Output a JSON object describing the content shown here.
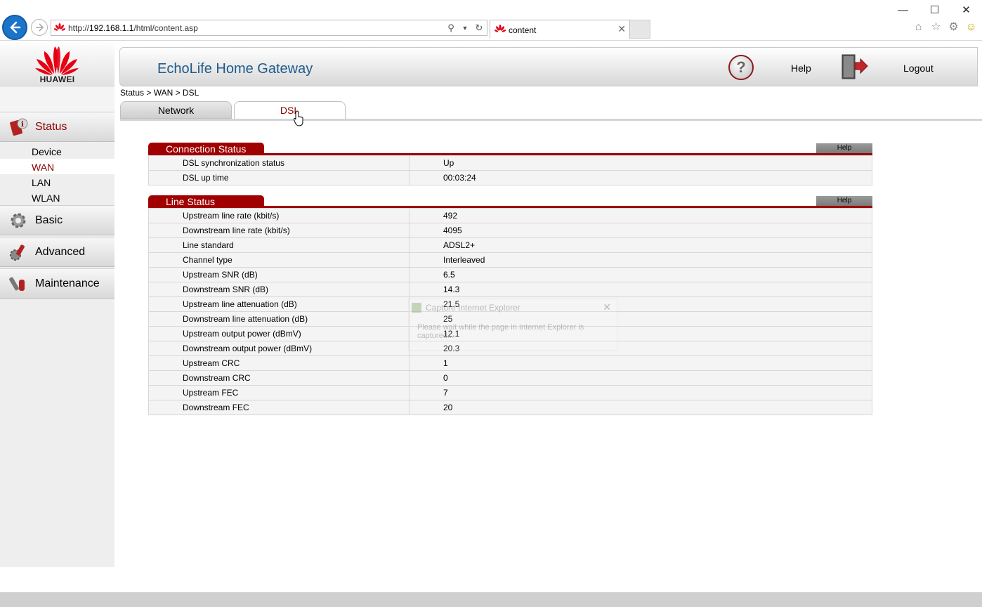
{
  "browser": {
    "url_prefix": "http://",
    "url_host": "192.168.1.1",
    "url_path": "/html/content.asp",
    "tab_title": "content",
    "window_controls": [
      "—",
      "☐",
      "✕"
    ]
  },
  "brand": {
    "logo_text": "HUAWEI",
    "brand_color": "#e60012"
  },
  "header": {
    "title": "EchoLife Home Gateway",
    "help_label": "Help",
    "logout_label": "Logout"
  },
  "sidebar": {
    "status": "Status",
    "sub_items": [
      "Device",
      "WAN",
      "LAN",
      "WLAN"
    ],
    "basic": "Basic",
    "advanced": "Advanced",
    "maintenance": "Maintenance"
  },
  "breadcrumb": "Status > WAN > DSL",
  "tabs": {
    "network": "Network",
    "dsl": "DSL"
  },
  "connection_status": {
    "title": "Connection Status",
    "help": "Help",
    "rows": [
      {
        "label": "DSL synchronization status",
        "value": "Up"
      },
      {
        "label": "DSL up time",
        "value": "00:03:24"
      }
    ]
  },
  "line_status": {
    "title": "Line Status",
    "help": "Help",
    "rows": [
      {
        "label": "Upstream line rate (kbit/s)",
        "value": "492"
      },
      {
        "label": "Downstream line rate (kbit/s)",
        "value": "4095"
      },
      {
        "label": "Line standard",
        "value": "ADSL2+"
      },
      {
        "label": "Channel type",
        "value": "Interleaved"
      },
      {
        "label": "Upstream SNR (dB)",
        "value": "6.5"
      },
      {
        "label": "Downstream SNR (dB)",
        "value": "14.3"
      },
      {
        "label": "Upstream line attenuation (dB)",
        "value": "21.5"
      },
      {
        "label": "Downstream line attenuation (dB)",
        "value": "25"
      },
      {
        "label": "Upstream output power (dBmV)",
        "value": "12.1"
      },
      {
        "label": "Downstream output power (dBmV)",
        "value": "20.3"
      },
      {
        "label": "Upstream CRC",
        "value": "1"
      },
      {
        "label": "Downstream CRC",
        "value": "0"
      },
      {
        "label": "Upstream FEC",
        "value": "7"
      },
      {
        "label": "Downstream FEC",
        "value": "20"
      }
    ]
  },
  "capture_overlay": {
    "title": "Capture Internet Explorer",
    "message": "Please wait while the page in Internet Explorer is captured..."
  },
  "colors": {
    "accent_red": "#a00000",
    "title_blue": "#1e5a8a",
    "active_nav": "#8b0000"
  }
}
